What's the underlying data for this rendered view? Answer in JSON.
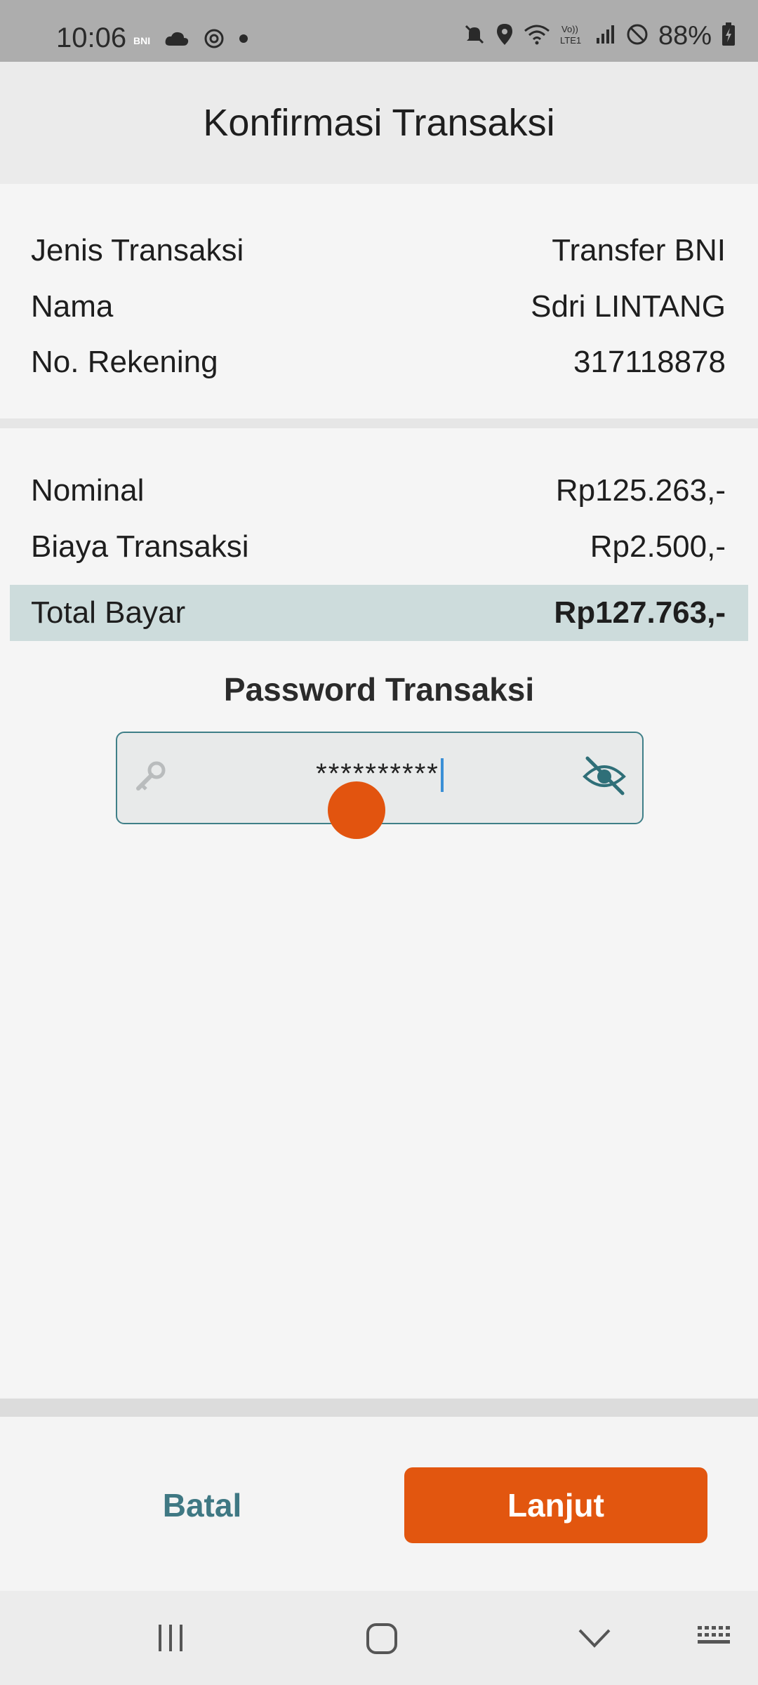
{
  "status_bar": {
    "time": "10:06",
    "bni_badge": "BNI",
    "battery": "88%",
    "icons": [
      "cloud-icon",
      "settings-icon",
      "dot-icon",
      "mute-icon",
      "location-icon",
      "wifi-icon",
      "volte-icon",
      "signal-icon",
      "blocked-icon",
      "battery-icon"
    ]
  },
  "header": {
    "title": "Konfirmasi Transaksi"
  },
  "details": {
    "jenis_label": "Jenis Transaksi",
    "jenis_value": "Transfer BNI",
    "nama_label": "Nama",
    "nama_value": "Sdri LINTANG",
    "rekening_label": "No. Rekening",
    "rekening_value": "317118878"
  },
  "amounts": {
    "nominal_label": "Nominal",
    "nominal_value": "Rp125.263,-",
    "biaya_label": "Biaya Transaksi",
    "biaya_value": "Rp2.500,-",
    "total_label": "Total Bayar",
    "total_value": "Rp127.763,-"
  },
  "password": {
    "title": "Password Transaksi",
    "value": "**********"
  },
  "buttons": {
    "cancel": "Batal",
    "next": "Lanjut"
  },
  "colors": {
    "accent": "#e2560f",
    "teal": "#3f7883",
    "total_bg": "#cddcdc"
  }
}
